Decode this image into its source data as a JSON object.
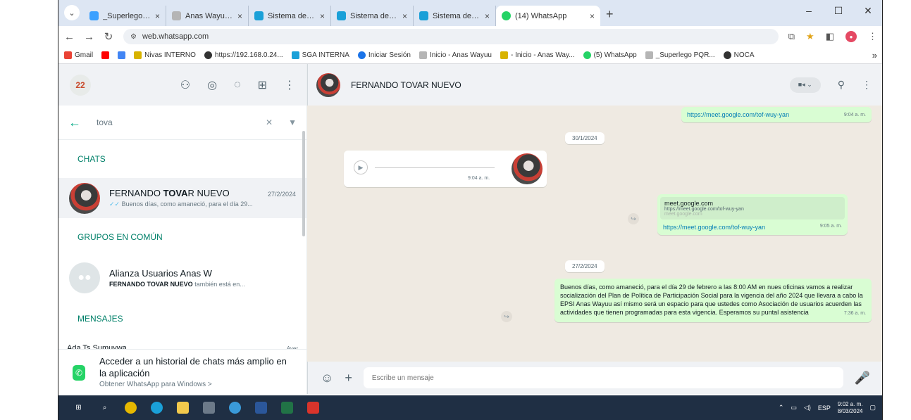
{
  "browser": {
    "tabs": [
      {
        "title": "_Superlego PQRS",
        "color": "#3aa0ff",
        "close": "×"
      },
      {
        "title": "Anas Wayuu EPSI -",
        "color": "#b5b5b5",
        "close": "×"
      },
      {
        "title": "Sistema de Gestión",
        "color": "#1aa0d8",
        "close": "×"
      },
      {
        "title": "Sistema de Gestión",
        "color": "#1aa0d8",
        "close": "×"
      },
      {
        "title": "Sistema de Gestión",
        "color": "#1aa0d8",
        "close": "×"
      },
      {
        "title": "(14) WhatsApp",
        "color": "#25d366",
        "close": "×"
      }
    ],
    "new_tab": "+",
    "window_controls": {
      "minimize": "–",
      "maximize": "☐",
      "close": "✕"
    },
    "url": "web.whatsapp.com",
    "bookmarks": [
      {
        "label": "Gmail",
        "color": "#ea4335"
      },
      {
        "label": "",
        "color": "#ff0000"
      },
      {
        "label": "",
        "color": "#4285f4"
      },
      {
        "label": "Nivas INTERNO",
        "color": "#d8b300"
      },
      {
        "label": "https://192.168.0.24...",
        "color": "#333"
      },
      {
        "label": "SGA INTERNA",
        "color": "#1aa0d8"
      },
      {
        "label": "Iniciar Sesión",
        "color": "#1a73e8"
      },
      {
        "label": "Inicio - Anas Wayuu",
        "color": "#b5b5b5"
      },
      {
        "label": "- Inicio - Anas Way...",
        "color": "#d8b300"
      },
      {
        "label": "(5) WhatsApp",
        "color": "#25d366"
      },
      {
        "label": "_Superlego PQR...",
        "color": "#b5b5b5"
      },
      {
        "label": "NOCA",
        "color": "#333"
      }
    ],
    "bookmarks_more": "»"
  },
  "left": {
    "avatar_text": "22",
    "search_value": "tova",
    "sections": {
      "chats": "CHATS",
      "groups": "GRUPOS EN COMÚN",
      "messages": "MENSAJES"
    },
    "chat": {
      "name_pre": "FERNANDO ",
      "name_bold": "TOVA",
      "name_post": "R NUEVO",
      "date": "27/2/2024",
      "preview": "Buenos días, como amaneció, para el día 29..."
    },
    "group": {
      "name": "Alianza Usuarios Anas W",
      "member_bold": "FERNANDO TOVAR NUEVO",
      "member_rest": " también está en..."
    },
    "message": {
      "name": "Ada Ts Sumuywa",
      "date": "Ayer"
    },
    "promo": {
      "title": "Acceder a un historial de chats más amplio en la aplicación",
      "link": "Obtener WhatsApp para Windows >"
    }
  },
  "right": {
    "contact_name": "FERNANDO TOVAR NUEVO",
    "messages": {
      "m1_link": "https://meet.google.com/tof-wuy-yan",
      "m1_time": "9:04 a. m.",
      "date1": "30/1/2024",
      "voice_time": "9:04 a. m.",
      "preview_title": "meet.google.com",
      "preview_url": "https://meet.google.com/tof-wuy-yan",
      "preview_domain": "meet.google.com",
      "m2_link": "https://meet.google.com/tof-wuy-yan",
      "m2_time": "9:05 a. m.",
      "date2": "27/2/2024",
      "long_text": "Buenos días, como amaneció, para el día 29 de febrero a las 8:00 AM en nues oficinas vamos a realizar socialización del Plan de Política de Participación Social para la vigencia del año 2024 que llevara a cabo la EPSI Anas Wayuu así mismo será un espacio para que ustedes como Asociación de usuarios acuerden las actividades que tienen programadas para esta vigencia. Esperamos su puntal asistencia",
      "long_time": "7:36 a. m."
    },
    "compose_placeholder": "Escribe un mensaje"
  },
  "taskbar": {
    "lang": "ESP",
    "time": "9:02 a. m.",
    "date": "8/03/2024"
  }
}
